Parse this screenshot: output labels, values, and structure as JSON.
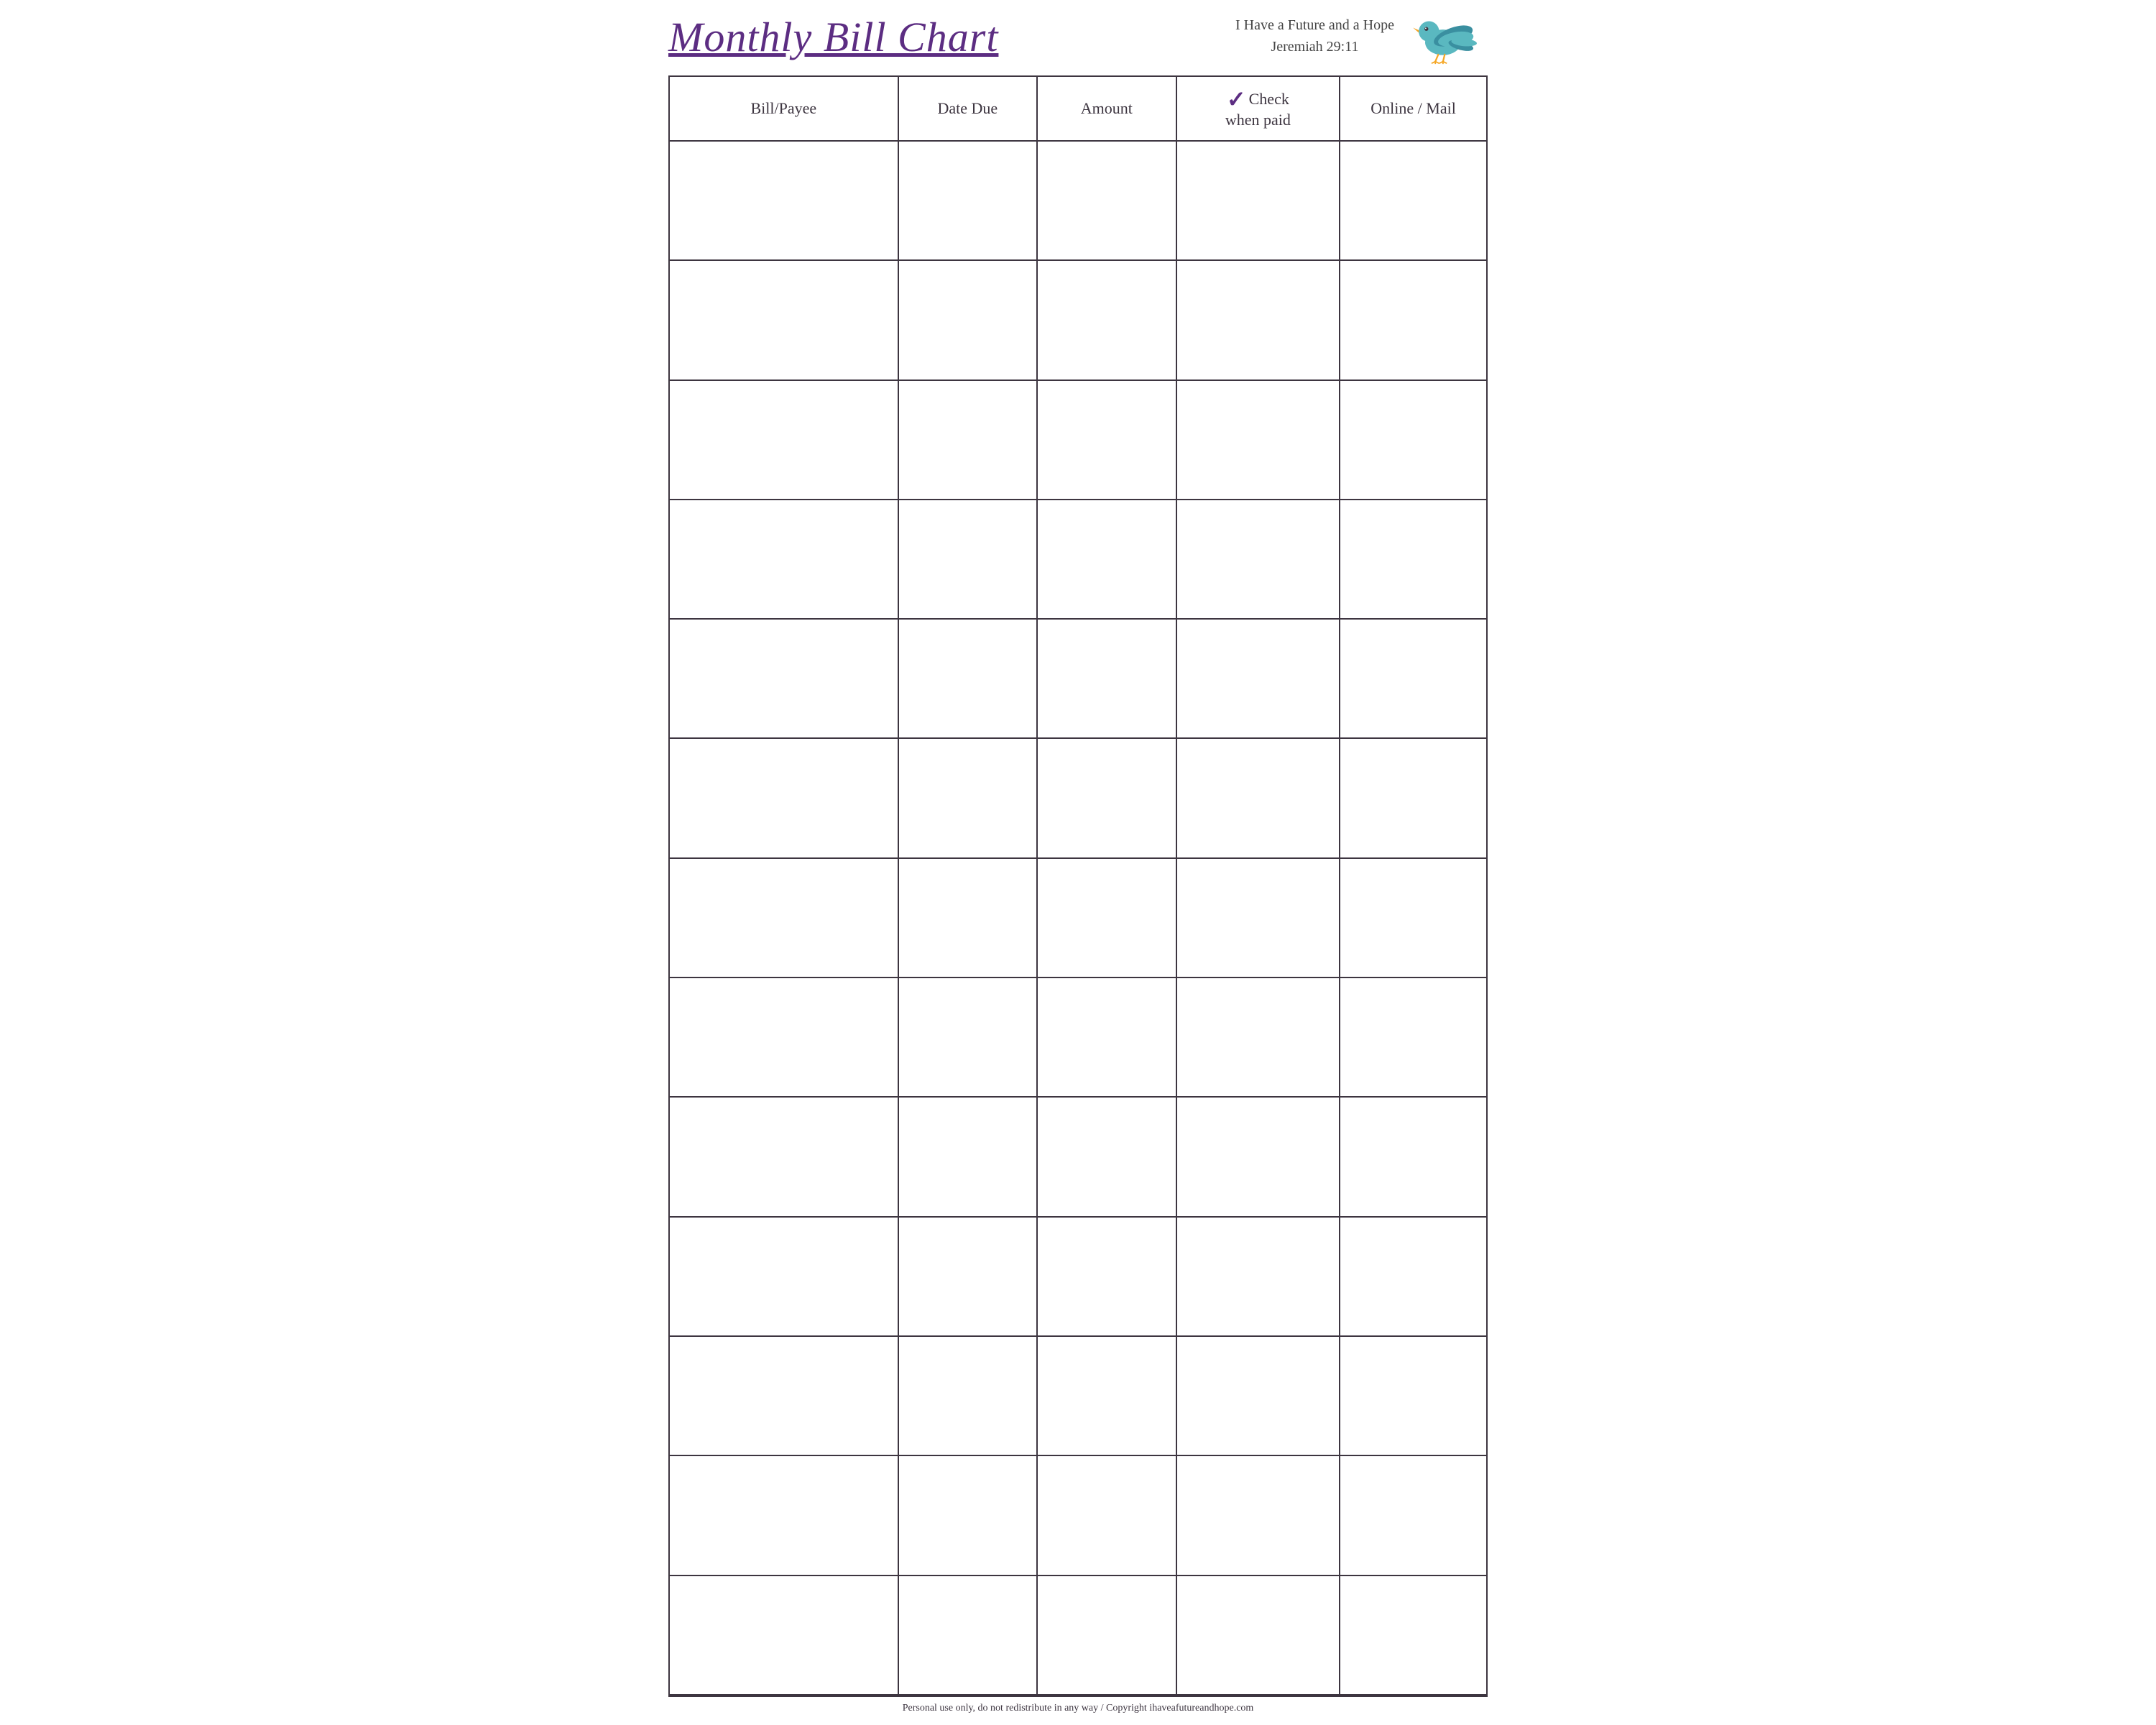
{
  "header": {
    "title": "Monthly Bill Chart",
    "scripture_line1": "I Have a Future and a Hope",
    "scripture_line2": "Jeremiah 29:11"
  },
  "table": {
    "columns": [
      {
        "id": "bill-payee",
        "label": "Bill/Payee"
      },
      {
        "id": "date-due",
        "label": "Date Due"
      },
      {
        "id": "amount",
        "label": "Amount"
      },
      {
        "id": "check-when-paid",
        "label": "Check when paid",
        "checkmark": "✓"
      },
      {
        "id": "online-mail",
        "label": "Online / Mail"
      }
    ],
    "row_count": 13
  },
  "footer": {
    "text": "Personal use only, do not redistribute in any way / Copyright ihaveafutureandhope.com"
  },
  "colors": {
    "title": "#5c2d82",
    "border": "#3d3540",
    "text": "#444444",
    "checkmark": "#5c2d82",
    "bird_body": "#5ab8c0",
    "bird_wing": "#3a8fa0",
    "bird_beak": "#f5a623",
    "bird_eye": "#3d3540"
  }
}
